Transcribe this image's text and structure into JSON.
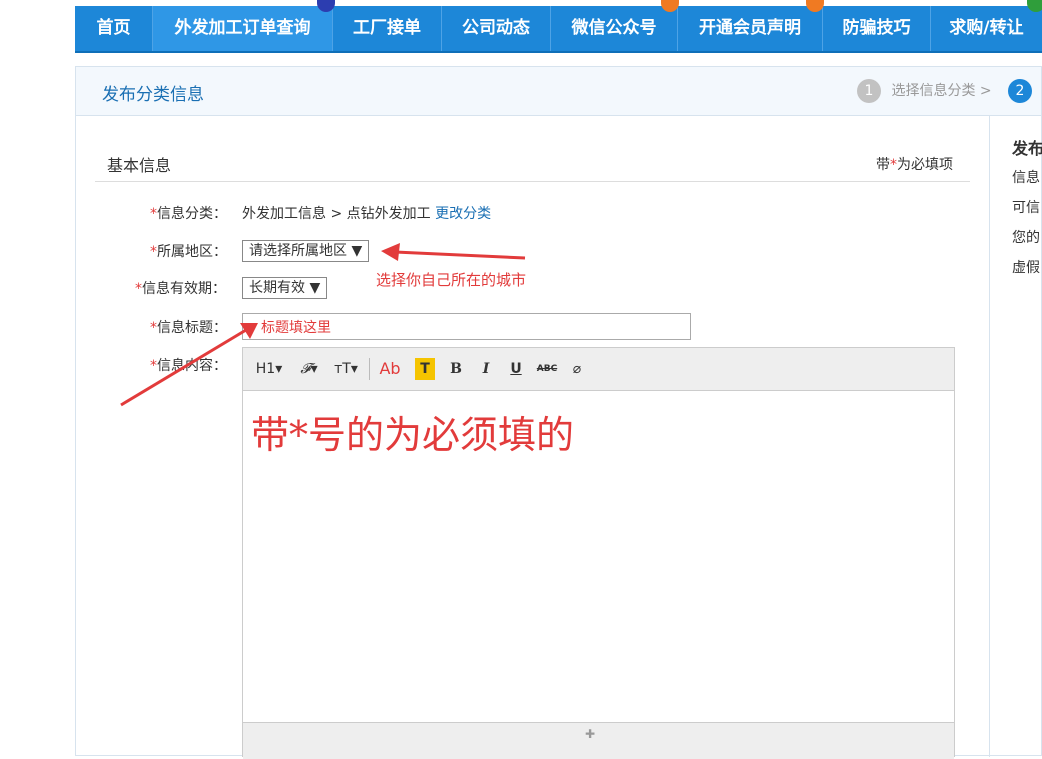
{
  "nav": {
    "items": [
      "首页",
      "外发加工订单查询",
      "工厂接单",
      "公司动态",
      "微信公众号",
      "开通会员声明",
      "防骗技巧",
      "求购/转让"
    ],
    "active_index": 1,
    "badge_colors": [
      "#2c3db0",
      "#f07a22",
      "#f07a22",
      "#2f9e3b"
    ]
  },
  "page": {
    "title": "发布分类信息",
    "steps": [
      {
        "num": "1",
        "label": "选择信息分类 >",
        "state": "done"
      },
      {
        "num": "2",
        "label": "",
        "state": "current"
      }
    ]
  },
  "side": {
    "title": "发布",
    "lines": [
      "信息",
      "可信",
      "您的",
      "虚假"
    ]
  },
  "form": {
    "section_title": "基本信息",
    "required_note_prefix": "带",
    "required_note_star": "*",
    "required_note_suffix": "为必填项",
    "star": "*",
    "category_label": "信息分类：",
    "category_value": "外发加工信息 > 点钻外发加工",
    "change_category_link": "更改分类",
    "region_label": "所属地区：",
    "region_select": "请选择所属地区 ▼",
    "validity_label": "信息有效期：",
    "validity_select": "长期有效 ▼",
    "title_label": "信息标题：",
    "title_input_value": "标题填这里",
    "content_label": "信息内容：",
    "editor_content": "带*号的为必须填的"
  },
  "toolbar": {
    "buttons": [
      "H1▾",
      "𝓕▾",
      "тT▾",
      "Ab",
      "T",
      "B",
      "I",
      "U",
      "ABC",
      "⌀"
    ]
  },
  "annotation": {
    "region_hint": "选择你自己所在的城市"
  },
  "colors": {
    "nav_bg": "#1d87d8",
    "accent_blue": "#1a6fb3",
    "required_red": "#e23b3b",
    "annotation_red": "#e23b3b"
  }
}
